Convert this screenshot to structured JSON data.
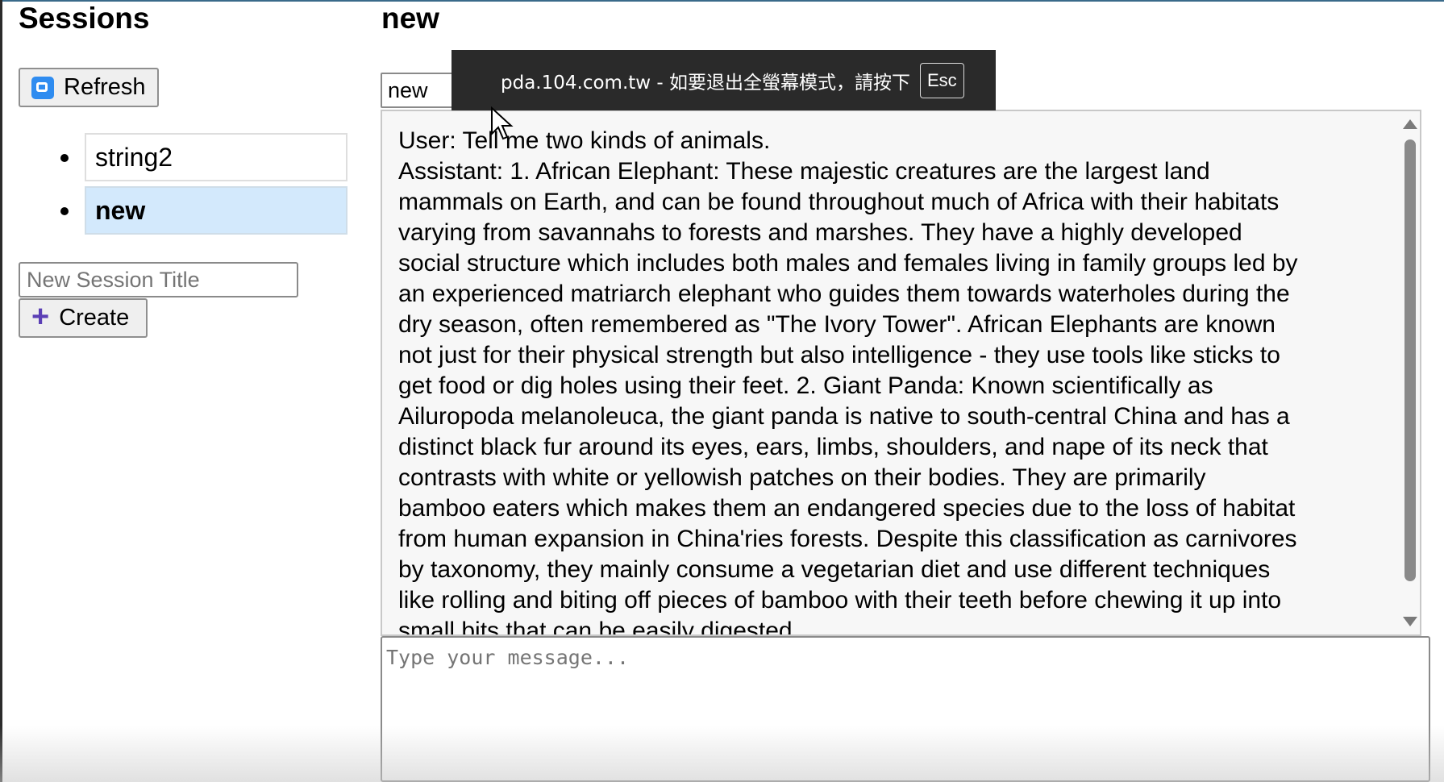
{
  "sidebar": {
    "title": "Sessions",
    "refresh_label": "Refresh",
    "sessions": [
      {
        "label": "string2",
        "active": false
      },
      {
        "label": "new",
        "active": true
      }
    ],
    "new_session_placeholder": "New Session Title",
    "create_label": "Create"
  },
  "chat": {
    "title": "new",
    "session_name_value": "new",
    "messages": [
      "User: Tell me two kinds of animals.",
      "Assistant: 1. African Elephant: These majestic creatures are the largest land",
      "mammals on Earth, and can be found throughout much of Africa with their habitats",
      "varying from savannahs to forests and marshes. They have a highly developed",
      "social structure which includes both males and females living in family groups led by",
      "an experienced matriarch elephant who guides them towards waterholes during the",
      "dry season, often remembered as \"The Ivory Tower\". African Elephants are known",
      "not just for their physical strength but also intelligence - they use tools like sticks to",
      "get food or dig holes using their feet. 2. Giant Panda: Known scientifically as",
      "Ailuropoda melanoleuca, the giant panda is native to south-central China and has a",
      "distinct black fur around its eyes, ears, limbs, shoulders, and nape of its neck that",
      "contrasts with white or yellowish patches on their bodies. They are primarily",
      "bamboo eaters which makes them an endangered species due to the loss of habitat",
      "from human expansion in China'ries forests. Despite this classification as carnivores",
      "by taxonomy, they mainly consume a vegetarian diet and use different techniques",
      "like rolling and biting off pieces of bamboo with their teeth before chewing it up into",
      "small bits that can be easily digested."
    ],
    "message_placeholder": "Type your message..."
  },
  "fullscreen_notice": {
    "text": "pda.104.com.tw - 如要退出全螢幕模式，請按下",
    "key": "Esc"
  },
  "colors": {
    "active_session_bg": "#d3e9fc",
    "refresh_icon": "#2f8cf0",
    "create_icon": "#5b3fb5",
    "overlay_bg": "#2a2a2a"
  },
  "icons": {
    "refresh": "refresh-icon",
    "create": "plus-icon",
    "cursor": "cursor-icon"
  }
}
